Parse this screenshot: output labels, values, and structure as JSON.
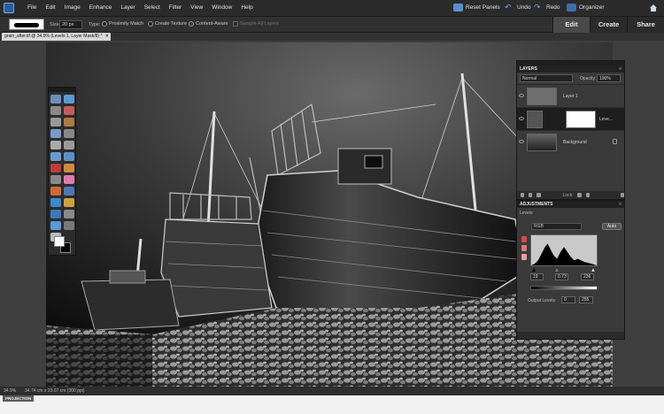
{
  "menubar": {
    "items": [
      "File",
      "Edit",
      "Image",
      "Enhance",
      "Layer",
      "Select",
      "Filter",
      "View",
      "Window",
      "Help"
    ],
    "reset_panels": "Reset Panels",
    "undo": "Undo",
    "redo": "Redo",
    "organizer": "Organizer"
  },
  "options": {
    "size_label": "Size:",
    "size_value": "20 px",
    "type_label": "Type:",
    "proximity": "Proximity Match",
    "create_texture": "Create Texture",
    "content_aware": "Content-Aware",
    "sample_all_layers": "Sample All Layers"
  },
  "mode_tabs": [
    "Edit",
    "Create",
    "Share"
  ],
  "document_tab": {
    "title": "grain_after.tif @ 34.9% (Levels 1, Layer Mask/8) *",
    "close": "×"
  },
  "layers_panel": {
    "title": "LAYERS",
    "blend_mode": "Normal",
    "opacity_label": "Opacity:",
    "opacity_value": "100%",
    "layers": [
      {
        "name": "Layer 1"
      },
      {
        "name": "Leve..."
      },
      {
        "name": "Background"
      }
    ],
    "lock_label": "Lock:"
  },
  "adjustments_panel": {
    "title": "ADJUSTMENTS",
    "subtitle": "Levels",
    "channel": "RGB",
    "auto": "Auto",
    "input_levels": [
      "19",
      "0.73",
      "236"
    ],
    "output_label": "Output Levels:",
    "output_levels": [
      "0",
      "255"
    ]
  },
  "status": {
    "zoom": "34.9%",
    "doc_info": "34.74 cm x 23.07 cm (300 ppi)"
  },
  "bottom_tab": "PROJECTION"
}
